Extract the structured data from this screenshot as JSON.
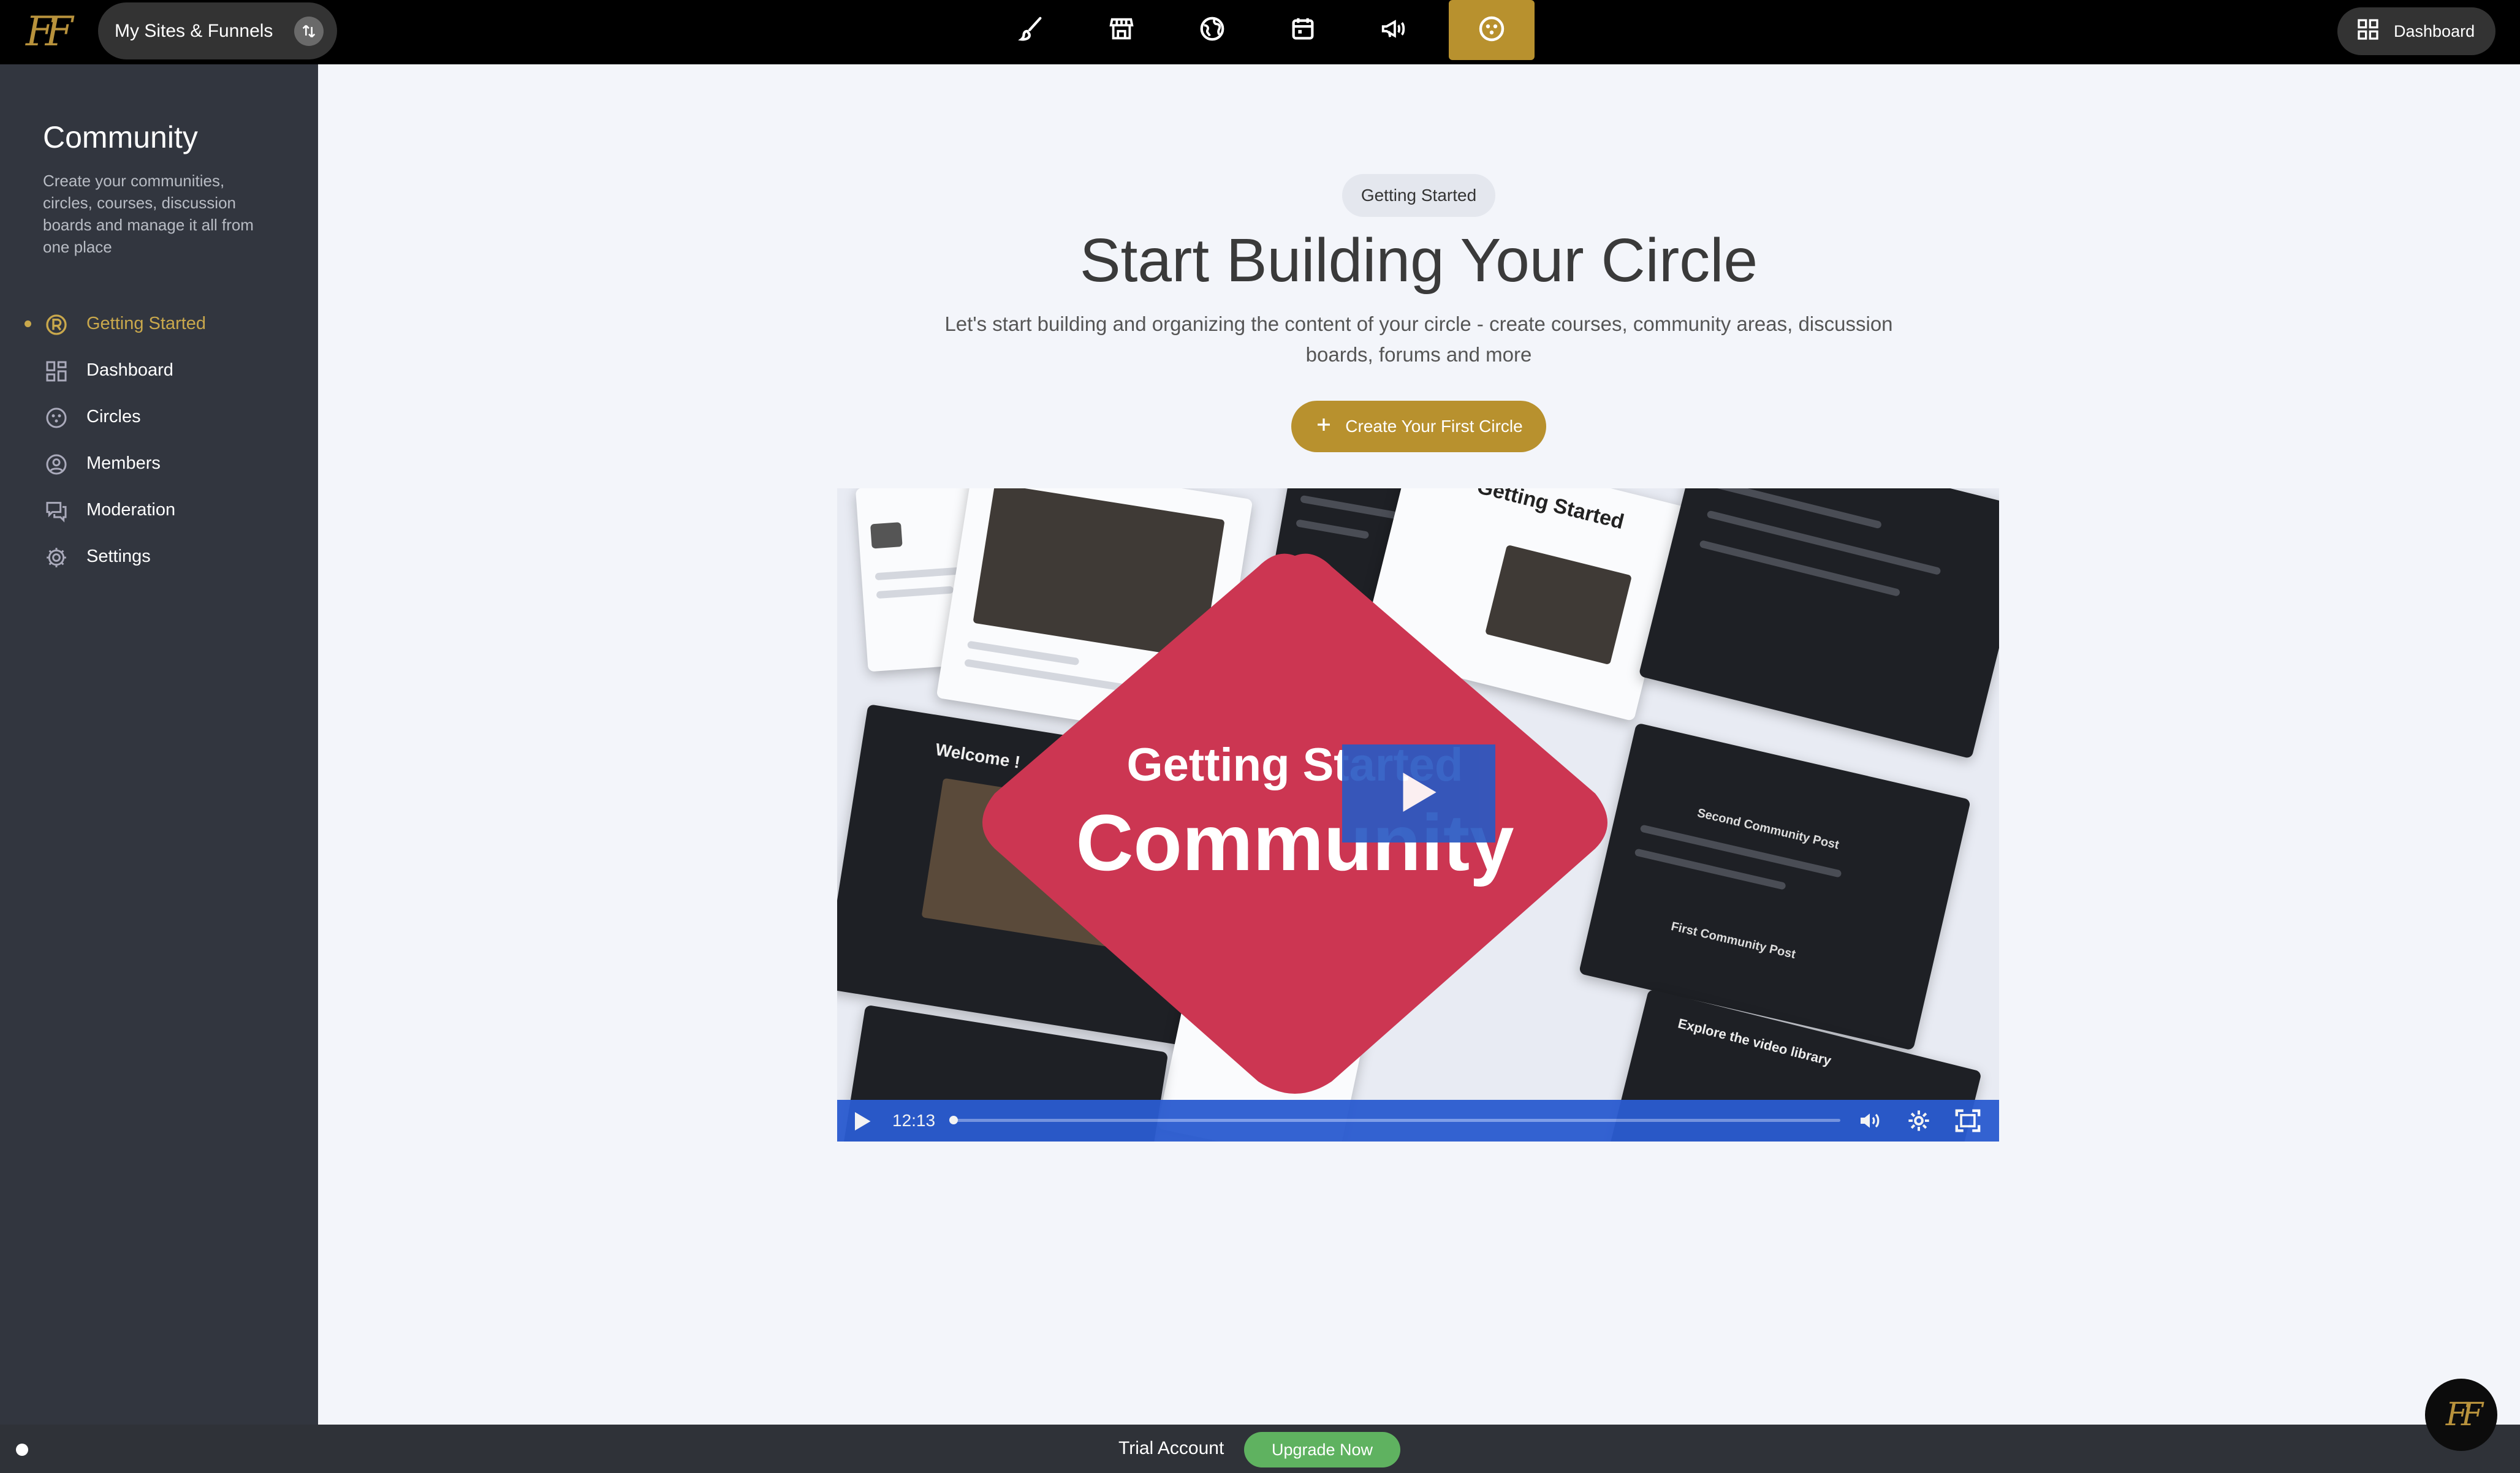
{
  "app": {
    "logo_text": "FF"
  },
  "topbar": {
    "site_switcher_label": "My Sites & Funnels",
    "nav_icons": [
      "brush-icon",
      "store-icon",
      "globe-icon",
      "calendar-icon",
      "megaphone-icon",
      "community-icon"
    ],
    "active_nav": "community-icon",
    "dashboard_label": "Dashboard"
  },
  "sidebar": {
    "title": "Community",
    "description": "Create your communities, circles, courses, discussion boards and manage it all from one place",
    "items": [
      {
        "label": "Getting Started",
        "icon": "getting-started-icon",
        "active": true
      },
      {
        "label": "Dashboard",
        "icon": "dashboard-grid-icon",
        "active": false
      },
      {
        "label": "Circles",
        "icon": "circles-icon",
        "active": false
      },
      {
        "label": "Members",
        "icon": "members-icon",
        "active": false
      },
      {
        "label": "Moderation",
        "icon": "moderation-icon",
        "active": false
      },
      {
        "label": "Settings",
        "icon": "gear-icon",
        "active": false
      }
    ]
  },
  "main": {
    "pill": "Getting Started",
    "headline": "Start Building Your Circle",
    "subline": "Let's start building and organizing the content of your circle - create courses, community areas, discussion boards, forums and more",
    "cta_label": "Create Your First Circle",
    "video": {
      "thumbnail_line1": "Getting Started",
      "thumbnail_line2": "Community",
      "tile_headings": [
        "Getting Started",
        "Welcome !",
        "Explore the video library",
        "Second Community Post",
        "First Community Post"
      ],
      "duration": "12:13",
      "progress": 0.0
    }
  },
  "footer": {
    "trial_label": "Trial Account",
    "upgrade_label": "Upgrade Now"
  },
  "colors": {
    "accent": "#b8912e",
    "sidebar": "#32363f",
    "video_control": "#2a5bd0",
    "upgrade": "#5fb260"
  }
}
